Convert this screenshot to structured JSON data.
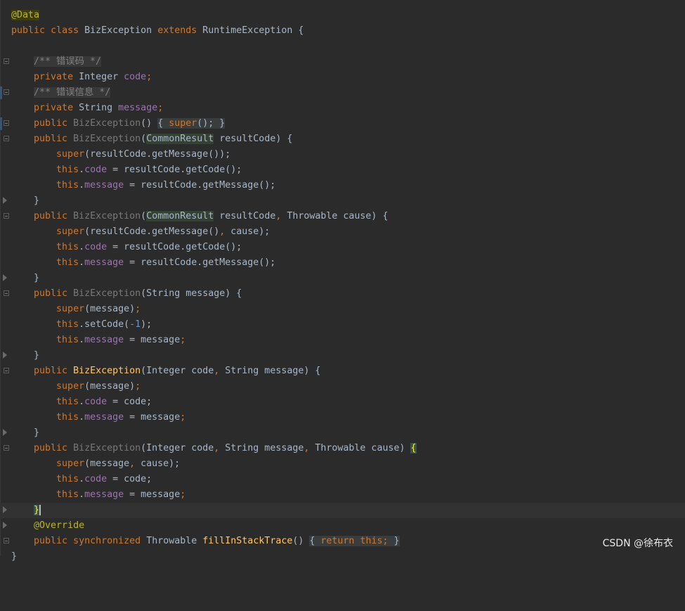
{
  "editor": {
    "annotation_data": "@Data",
    "class_decl": {
      "kw_public": "public",
      "kw_class": "class",
      "name": "BizException",
      "kw_extends": "extends",
      "parent": "RuntimeException",
      "brace": " {"
    },
    "comment_code": "/** 错误码 */",
    "field_code": {
      "kw": "private",
      "type": "Integer",
      "name": "code",
      "semi": ";"
    },
    "comment_message": "/** 错误信息 */",
    "field_message": {
      "kw": "private",
      "type": "String",
      "name": "message",
      "semi": ";"
    },
    "ctor0": {
      "kw": "public",
      "name": "BizException",
      "params": "()",
      "body_open": "{ ",
      "super": "super",
      "call": "();",
      "body_close": " }"
    },
    "ctor1": {
      "sig_kw": "public",
      "name": "BizException",
      "open": "(",
      "ptype": "CommonResult",
      "rest": " resultCode) {",
      "super_kw": "super",
      "super_args": "(resultCode.getMessage());",
      "this1": "this",
      "f1": "code",
      "rhs1": " = resultCode.getCode();",
      "this2": "this",
      "f2": "message",
      "rhs2": " = resultCode.getMessage();",
      "close": "}"
    },
    "ctor2": {
      "sig_kw": "public",
      "name": "BizException",
      "open": "(",
      "ptype": "CommonResult",
      "rest1": " resultCode",
      "comma": ",",
      "rest2": " Throwable cause) {",
      "super_kw": "super",
      "super_args1": "(resultCode.getMessage()",
      "super_comma": ",",
      "super_args2": " cause);",
      "this1": "this",
      "f1": "code",
      "rhs1": " = resultCode.getCode();",
      "this2": "this",
      "f2": "message",
      "rhs2": " = resultCode.getMessage();",
      "close": "}"
    },
    "ctor3": {
      "sig_kw": "public",
      "name": "BizException",
      "params": "(String message) {",
      "super_kw": "super",
      "super_args": "(message)",
      "semi1": ";",
      "this1": "this",
      "call1": ".setCode(",
      "num": "-1",
      "call1_end": ");",
      "this2": "this",
      "f2": "message",
      "rhs2": " = message",
      "semi2": ";",
      "close": "}"
    },
    "ctor4": {
      "sig_kw": "public",
      "name": "BizException",
      "p1": "(Integer code",
      "comma": ",",
      "p2": " String message) {",
      "super_kw": "super",
      "super_args": "(message)",
      "semi1": ";",
      "this1": "this",
      "f1": "code",
      "rhs1": " = code;",
      "this2": "this",
      "f2": "message",
      "rhs2": " = message",
      "semi2": ";",
      "close": "}"
    },
    "ctor5": {
      "sig_kw": "public",
      "name": "BizException",
      "p1": "(Integer code",
      "c1": ",",
      "p2": " String message",
      "c2": ",",
      "p3": " Throwable cause) ",
      "brace": "{",
      "super_kw": "super",
      "super_args1": "(message",
      "super_comma": ",",
      "super_args2": " cause);",
      "this1": "this",
      "f1": "code",
      "rhs1": " = code;",
      "this2": "this",
      "f2": "message",
      "rhs2": " = message",
      "semi2": ";",
      "close": "}"
    },
    "override": "@Override",
    "fill": {
      "kw1": "public",
      "kw2": "synchronized",
      "type": "Throwable",
      "name": "fillInStackTrace",
      "params": "()",
      "body_open": "{ ",
      "ret": "return",
      "this_kw": "this",
      "semi": ";",
      "body_close": " }"
    },
    "final_brace": "}"
  },
  "watermark": "CSDN @徐布衣"
}
